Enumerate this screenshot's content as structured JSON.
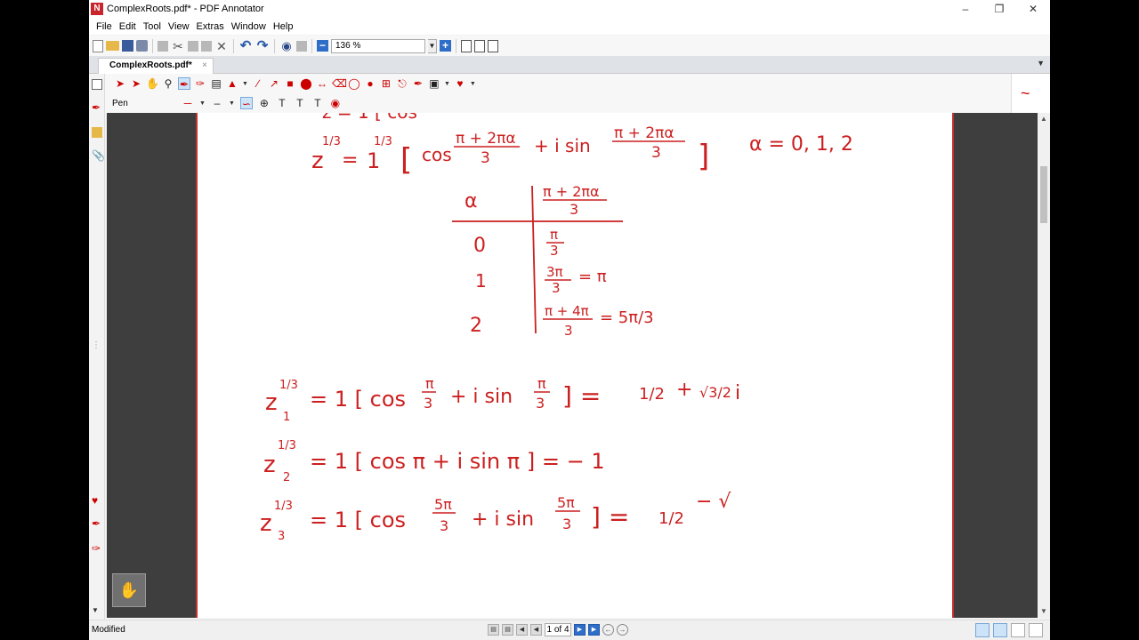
{
  "window": {
    "title": "ComplexRoots.pdf* - PDF Annotator",
    "app_icon_letter": "N",
    "minimize": "–",
    "maximize": "❐",
    "close": "✕"
  },
  "menu": [
    "File",
    "Edit",
    "Tool",
    "View",
    "Extras",
    "Window",
    "Help"
  ],
  "toolbar": {
    "zoom_value": "136 %"
  },
  "tab": {
    "label": "ComplexRoots.pdf*",
    "close": "×"
  },
  "penbar": {
    "tool_label": "Pen",
    "text_tool_1": "T",
    "text_tool_2": "T",
    "text_tool_3": "T",
    "preview_stroke": "~"
  },
  "status": {
    "text": "Modified",
    "page_indicator": "1 of 4"
  },
  "colors": {
    "accent_red": "#cc1f1f",
    "workspace": "#3e3e3e",
    "toolbar_blue": "#2e6dc8"
  },
  "math": {
    "line_1_lhs": "z",
    "line_1_exp": "1/3",
    "line_1_one": "1",
    "line_1_cos": "cos",
    "line_1_frac_num": "π + 2πα",
    "line_1_frac_den": "3",
    "line_1_isin": "+ i sin",
    "line_1_alpha": "α = 0, 1, 2",
    "table_header_alpha": "α",
    "table_header_num": "π + 2πα",
    "table_header_den": "3",
    "table_rows": [
      {
        "alpha": "0",
        "num": "π",
        "den": "3",
        "eq": ""
      },
      {
        "alpha": "1",
        "num": "3π",
        "den": "3",
        "eq": "= π"
      },
      {
        "alpha": "2",
        "num": "π + 4π",
        "den": "3",
        "eq": "= 5π/3"
      }
    ],
    "z1_sub": "1",
    "z1_body": "= 1 [ cos",
    "z1_frac_num": "π",
    "z1_frac_den": "3",
    "z1_mid": "+ i sin",
    "z1_result": "] =",
    "z1_half": "1/2",
    "z1_plus": "+",
    "z1_root": "√3/2",
    "z1_i": "i",
    "z2_sub": "2",
    "z2_body": "= 1 [ cos π + i sin π ] = − 1",
    "z3_sub": "3",
    "z3_body": "= 1 [ cos",
    "z3_frac_num": "5π",
    "z3_frac_den": "3",
    "z3_mid": "+ i sin",
    "z3_result": "] =",
    "z3_half": "1/2",
    "z3_minus": "− √"
  }
}
